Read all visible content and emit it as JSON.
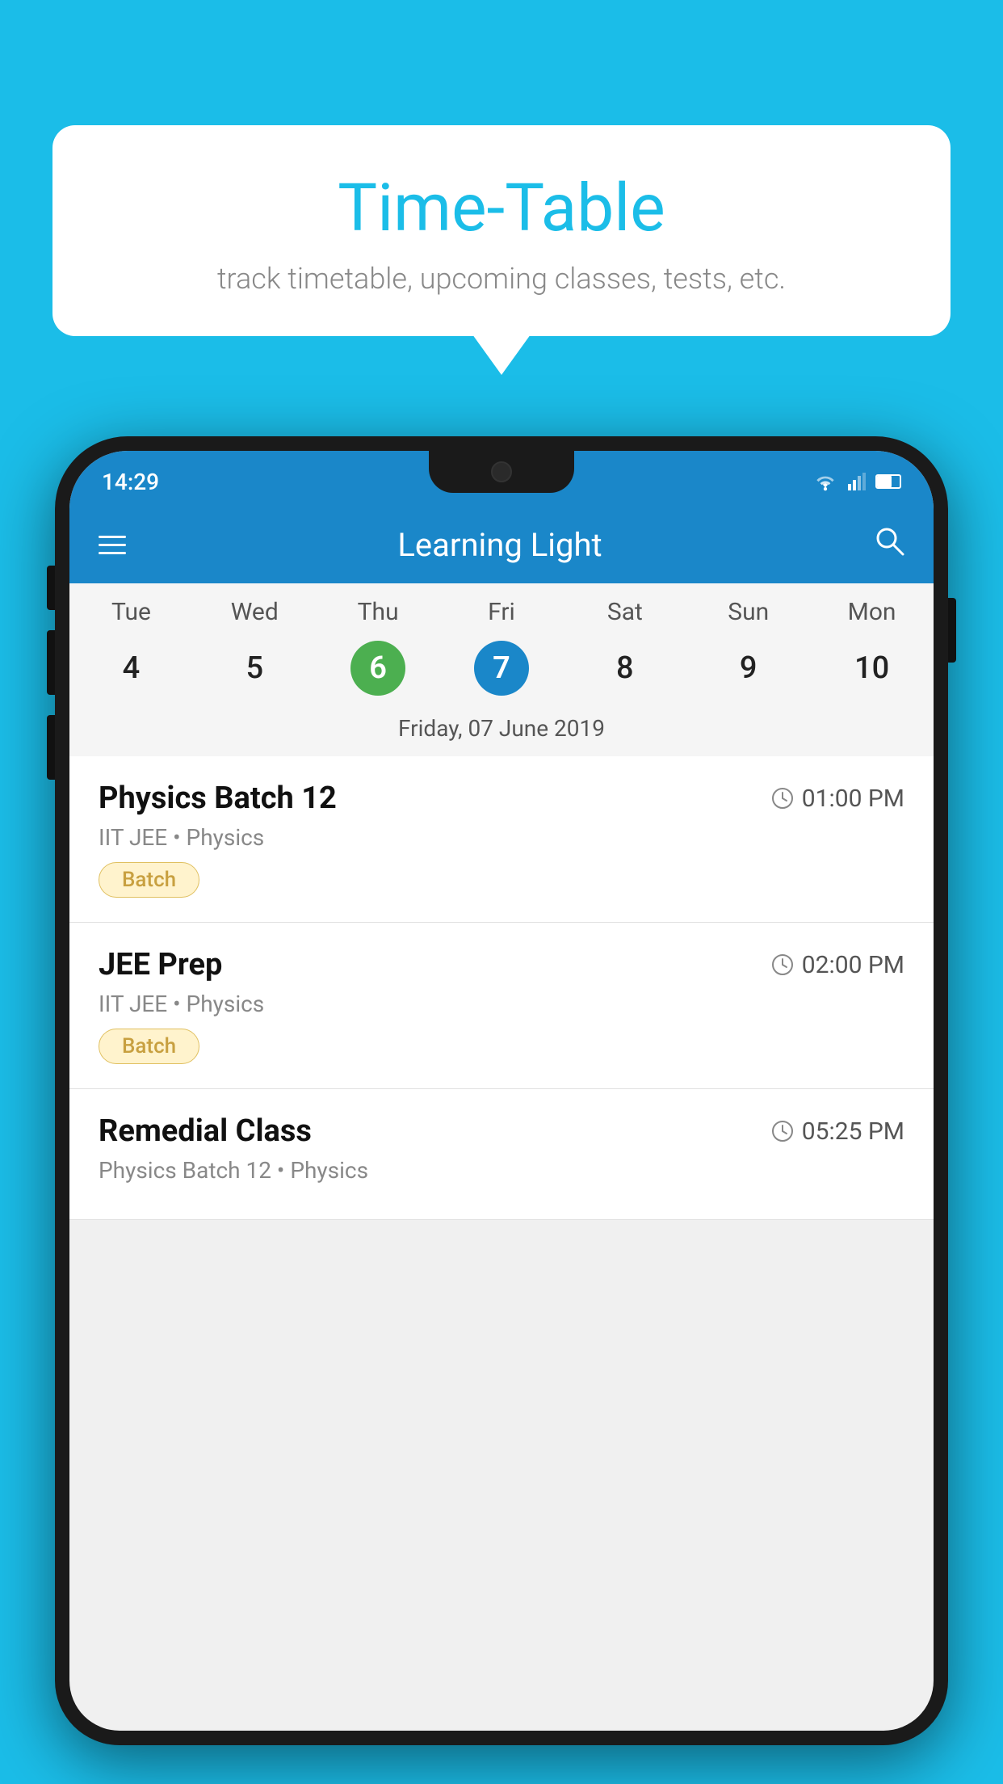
{
  "background_color": "#1bbde8",
  "bubble": {
    "title": "Time-Table",
    "subtitle": "track timetable, upcoming classes, tests, etc."
  },
  "app": {
    "toolbar_title": "Learning Light",
    "status_time": "14:29"
  },
  "calendar": {
    "days_of_week": [
      "Tue",
      "Wed",
      "Thu",
      "Fri",
      "Sat",
      "Sun",
      "Mon"
    ],
    "dates": [
      "4",
      "5",
      "6",
      "7",
      "8",
      "9",
      "10"
    ],
    "today_index": 2,
    "selected_index": 3,
    "selected_label": "Friday, 07 June 2019"
  },
  "schedule": [
    {
      "title": "Physics Batch 12",
      "time": "01:00 PM",
      "subtitle": "IIT JEE • Physics",
      "badge": "Batch"
    },
    {
      "title": "JEE Prep",
      "time": "02:00 PM",
      "subtitle": "IIT JEE • Physics",
      "badge": "Batch"
    },
    {
      "title": "Remedial Class",
      "time": "05:25 PM",
      "subtitle": "Physics Batch 12 • Physics",
      "badge": ""
    }
  ]
}
